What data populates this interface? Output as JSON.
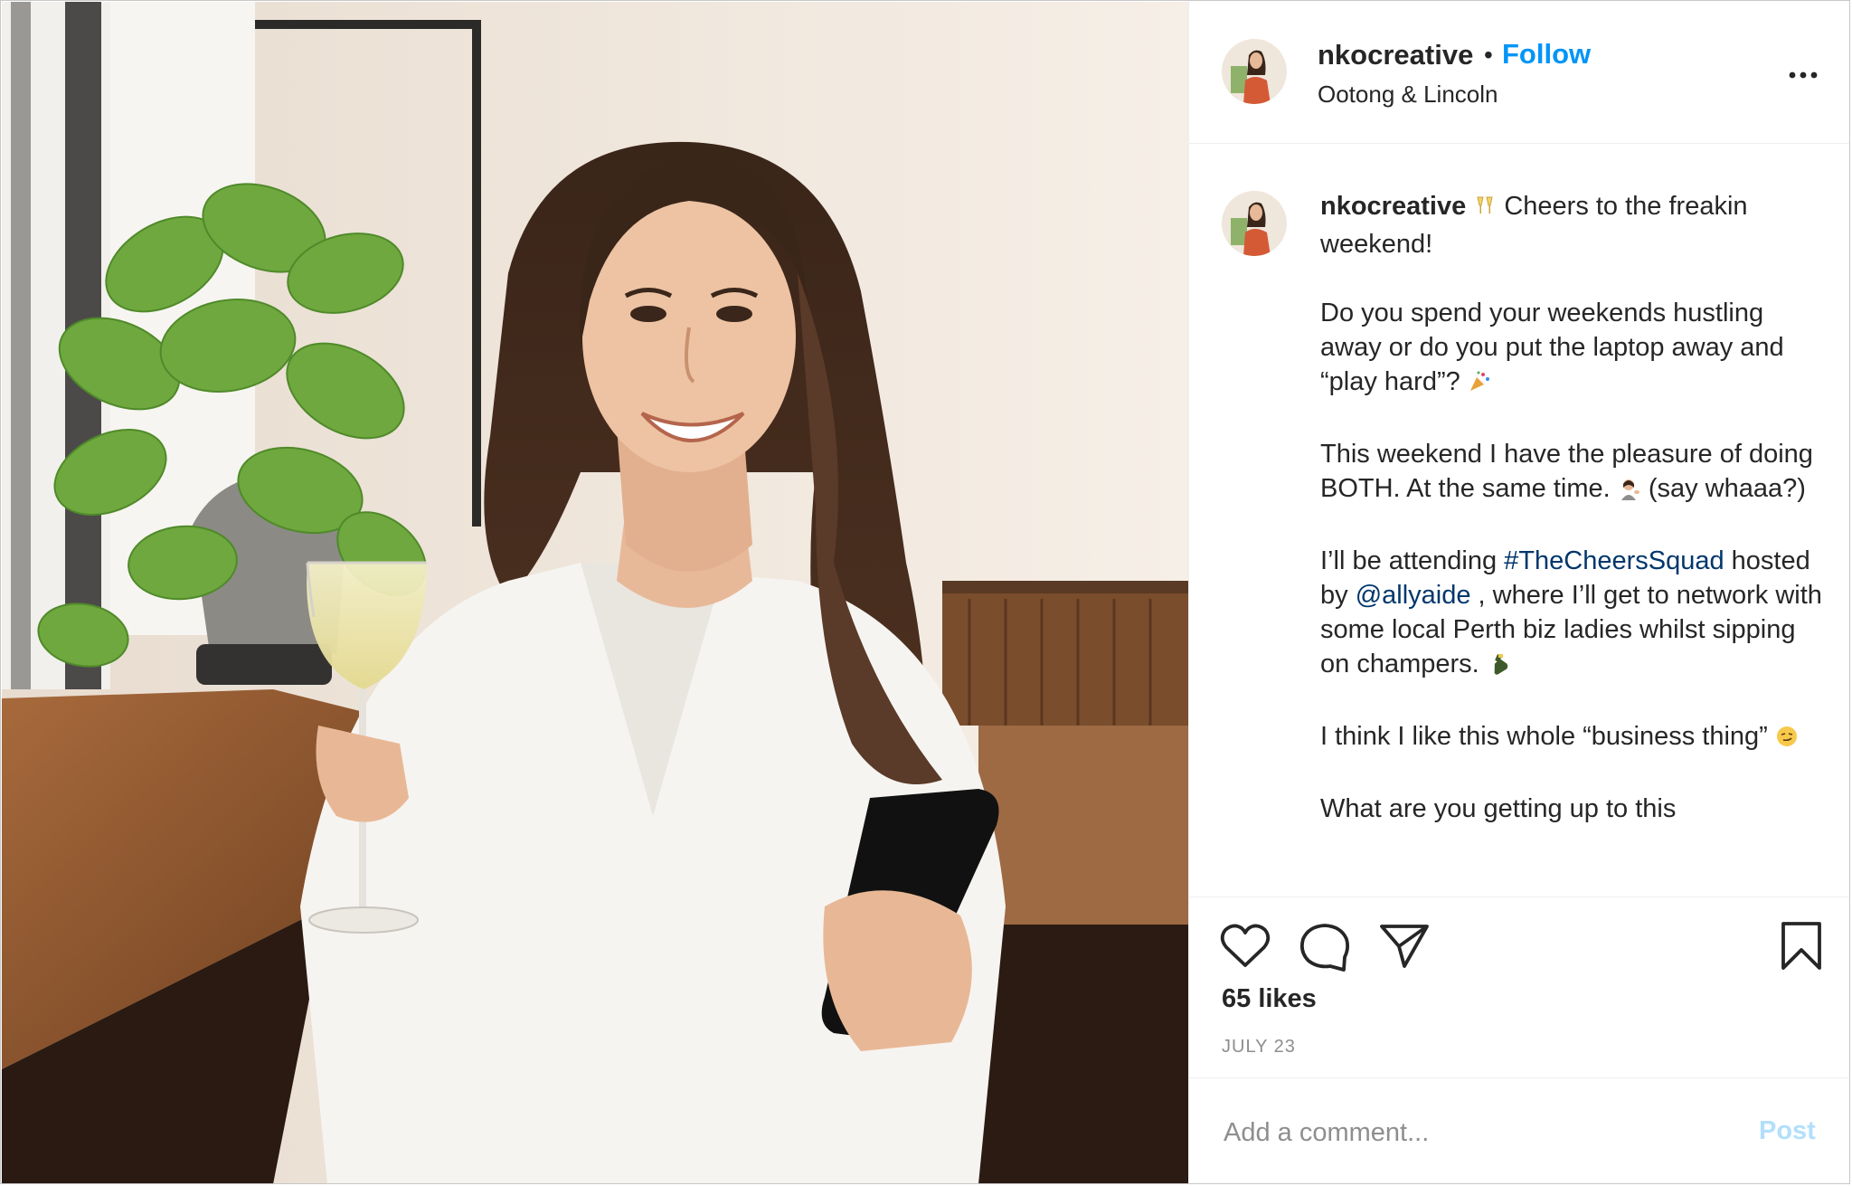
{
  "post": {
    "username": "nkocreative",
    "separator": "•",
    "follow_label": "Follow",
    "location": "Ootong & Lincoln",
    "more_icon": "more-horizontal-icon"
  },
  "caption": {
    "username": "nkocreative",
    "p1_rest": "Cheers to the freakin weekend!",
    "p2": "Do you spend your weekends hustling away or do you put the laptop away and “play hard”?",
    "p3a": "This weekend I have the pleasure of doing BOTH. At the same time.",
    "p3b": "(say whaaa?)",
    "p4_pre": "I’ll be attending",
    "p4_hashtag": "#TheCheersSquad",
    "p4_mid": "hosted by",
    "p4_mention": "@allyaide",
    "p4_post": ", where I’ll get to network with some local Perth biz ladies whilst sipping on champers.",
    "p5": "I think I like this whole “business thing”",
    "p6": "What are you getting up to this"
  },
  "actions": {
    "like_icon": "heart-icon",
    "comment_icon": "comment-icon",
    "share_icon": "share-icon",
    "save_icon": "bookmark-icon",
    "likes": "65 likes",
    "date": "JULY 23"
  },
  "comment": {
    "placeholder": "Add a comment...",
    "post_label": "Post"
  },
  "colors": {
    "follow": "#0095f6",
    "link": "#00376b",
    "post_disabled": "#b2dffc",
    "muted": "#8e8e8e"
  }
}
